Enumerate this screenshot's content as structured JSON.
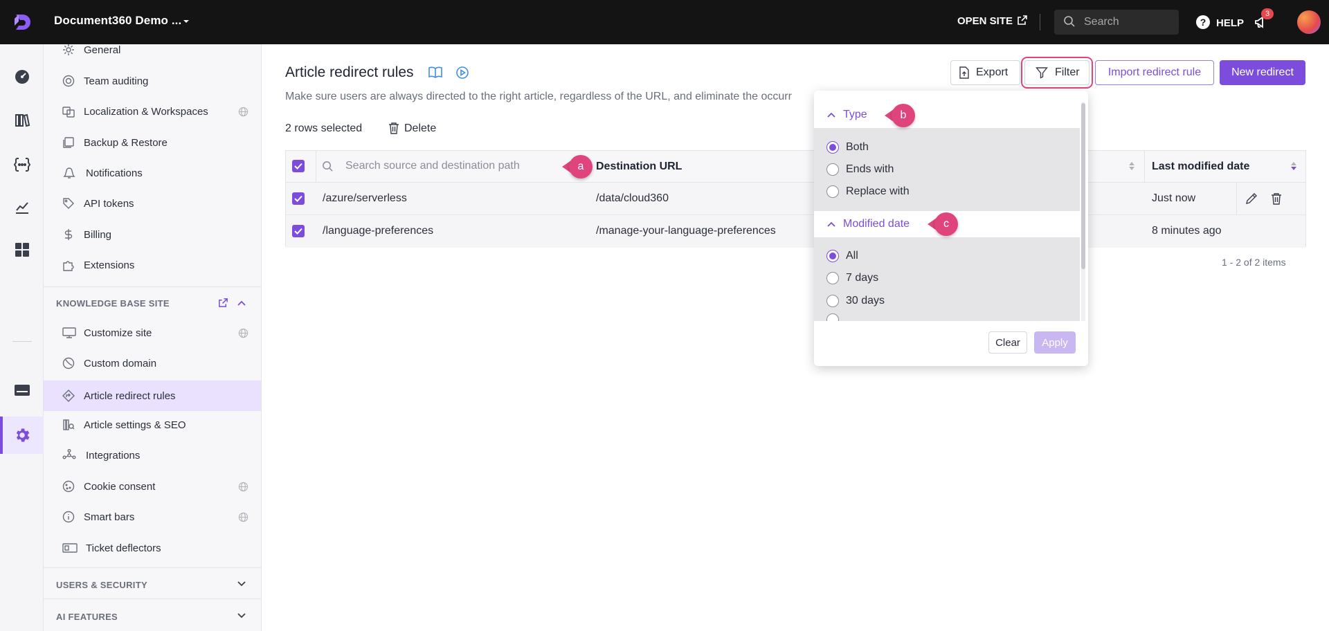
{
  "topbar": {
    "project_name": "Document360 Demo ...",
    "open_site": "OPEN SITE",
    "search_placeholder": "Search",
    "help": "HELP",
    "notification_count": "3"
  },
  "sidebar": {
    "items_top": [
      {
        "label": "General",
        "icon": "gear-icon"
      },
      {
        "label": "Team auditing",
        "icon": "audit-icon"
      },
      {
        "label": "Localization & Workspaces",
        "icon": "localization-icon",
        "globe": true
      },
      {
        "label": "Backup & Restore",
        "icon": "backup-icon"
      },
      {
        "label": "Notifications",
        "icon": "notification-icon"
      },
      {
        "label": "API tokens",
        "icon": "tag-icon"
      },
      {
        "label": "Billing",
        "icon": "dollar-icon"
      },
      {
        "label": "Extensions",
        "icon": "puzzle-icon"
      }
    ],
    "kb_section_title": "KNOWLEDGE BASE SITE",
    "items_kb": [
      {
        "label": "Customize site",
        "icon": "monitor-icon",
        "globe": true
      },
      {
        "label": "Custom domain",
        "icon": "domain-icon"
      },
      {
        "label": "Article redirect rules",
        "icon": "redirect-icon",
        "active": true
      },
      {
        "label": "Article settings & SEO",
        "icon": "seo-icon"
      },
      {
        "label": "Integrations",
        "icon": "integrations-icon"
      },
      {
        "label": "Cookie consent",
        "icon": "cookie-icon",
        "globe": true
      },
      {
        "label": "Smart bars",
        "icon": "info-icon",
        "globe": true
      },
      {
        "label": "Ticket deflectors",
        "icon": "ticket-icon"
      }
    ],
    "users_section_title": "USERS & SECURITY",
    "ai_section_title": "AI FEATURES"
  },
  "main": {
    "title": "Article redirect rules",
    "description": "Make sure users are always directed to the right article, regardless of the URL, and eliminate the occurr",
    "export": "Export",
    "filter": "Filter",
    "import": "Import redirect rule",
    "new_redirect": "New redirect",
    "rows_selected": "2 rows selected",
    "delete": "Delete",
    "table": {
      "search_placeholder": "Search source and destination path",
      "col_destination": "Destination URL",
      "col_modified": "Last modified date",
      "rows": [
        {
          "source": "/azure/serverless",
          "destination": "/data/cloud360",
          "modified": "Just now"
        },
        {
          "source": "/language-preferences",
          "destination": "/manage-your-language-preferences",
          "modified": "8 minutes ago"
        }
      ]
    },
    "paging": "1 - 2 of 2 items"
  },
  "filter_dropdown": {
    "type_title": "Type",
    "type_options": [
      "Both",
      "Ends with",
      "Replace with"
    ],
    "type_selected": "Both",
    "date_title": "Modified date",
    "date_options": [
      "All",
      "7 days",
      "30 days"
    ],
    "date_selected": "All",
    "clear": "Clear",
    "apply": "Apply"
  },
  "callouts": {
    "a": "a",
    "b": "b",
    "c": "c"
  },
  "colors": {
    "accent": "#7c4ddc",
    "callout": "#e0447c",
    "topbar": "#141414"
  }
}
